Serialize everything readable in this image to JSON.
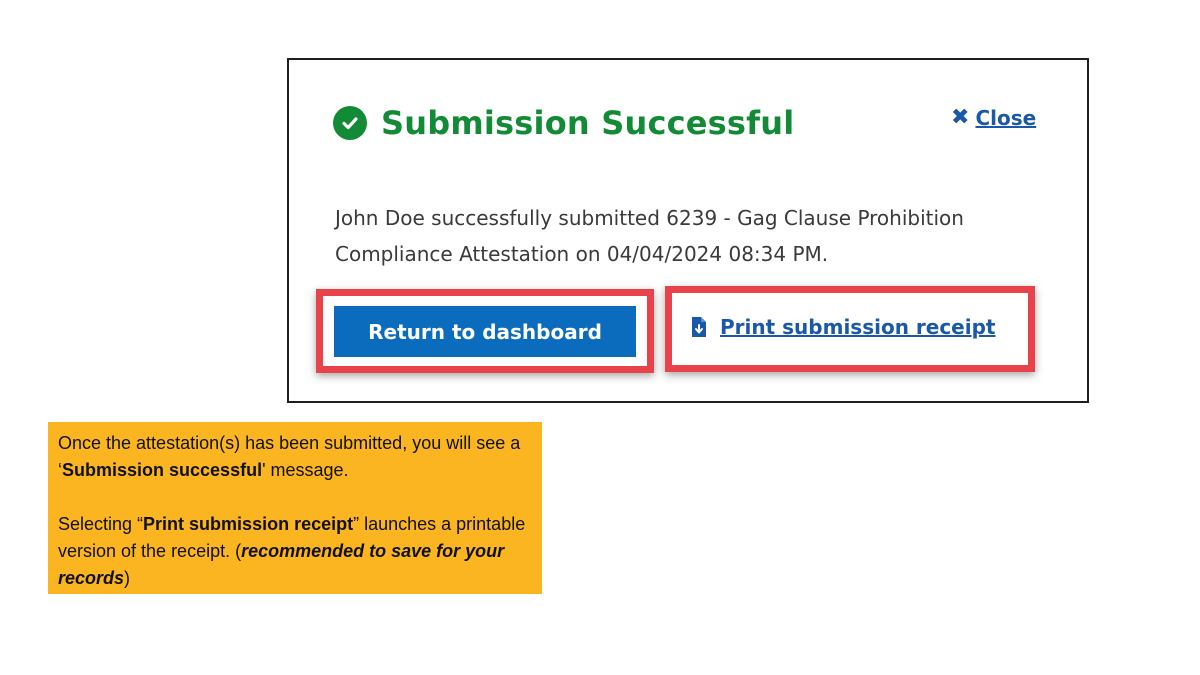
{
  "modal": {
    "title": "Submission Successful",
    "close_label": "Close",
    "message_line1": "John Doe successfully submitted 6239 - Gag Clause Prohibition",
    "message_line2": "Compliance Attestation on 04/04/2024 08:34 PM.",
    "return_button_label": "Return to dashboard",
    "print_link_label": "Print submission receipt",
    "icons": {
      "success": "check-circle-icon",
      "close": "close-x-icon",
      "print": "file-download-icon"
    }
  },
  "callout": {
    "p1_part1": "Once the attestation(s) has been submitted, you will see a ‘",
    "p1_bold": "Submission successful",
    "p1_part2": "' message.",
    "p2_part1": "Selecting “",
    "p2_bold": "Print submission receipt",
    "p2_part2": "” launches a printable version of the receipt. (",
    "p2_bold_italic": "recommended to save for your records",
    "p2_part3": ")"
  },
  "colors": {
    "success_green": "#138a36",
    "link_blue": "#1a58a8",
    "button_blue": "#0b6cbd",
    "highlight_red": "#e8434a",
    "callout_yellow": "#fbb521"
  }
}
